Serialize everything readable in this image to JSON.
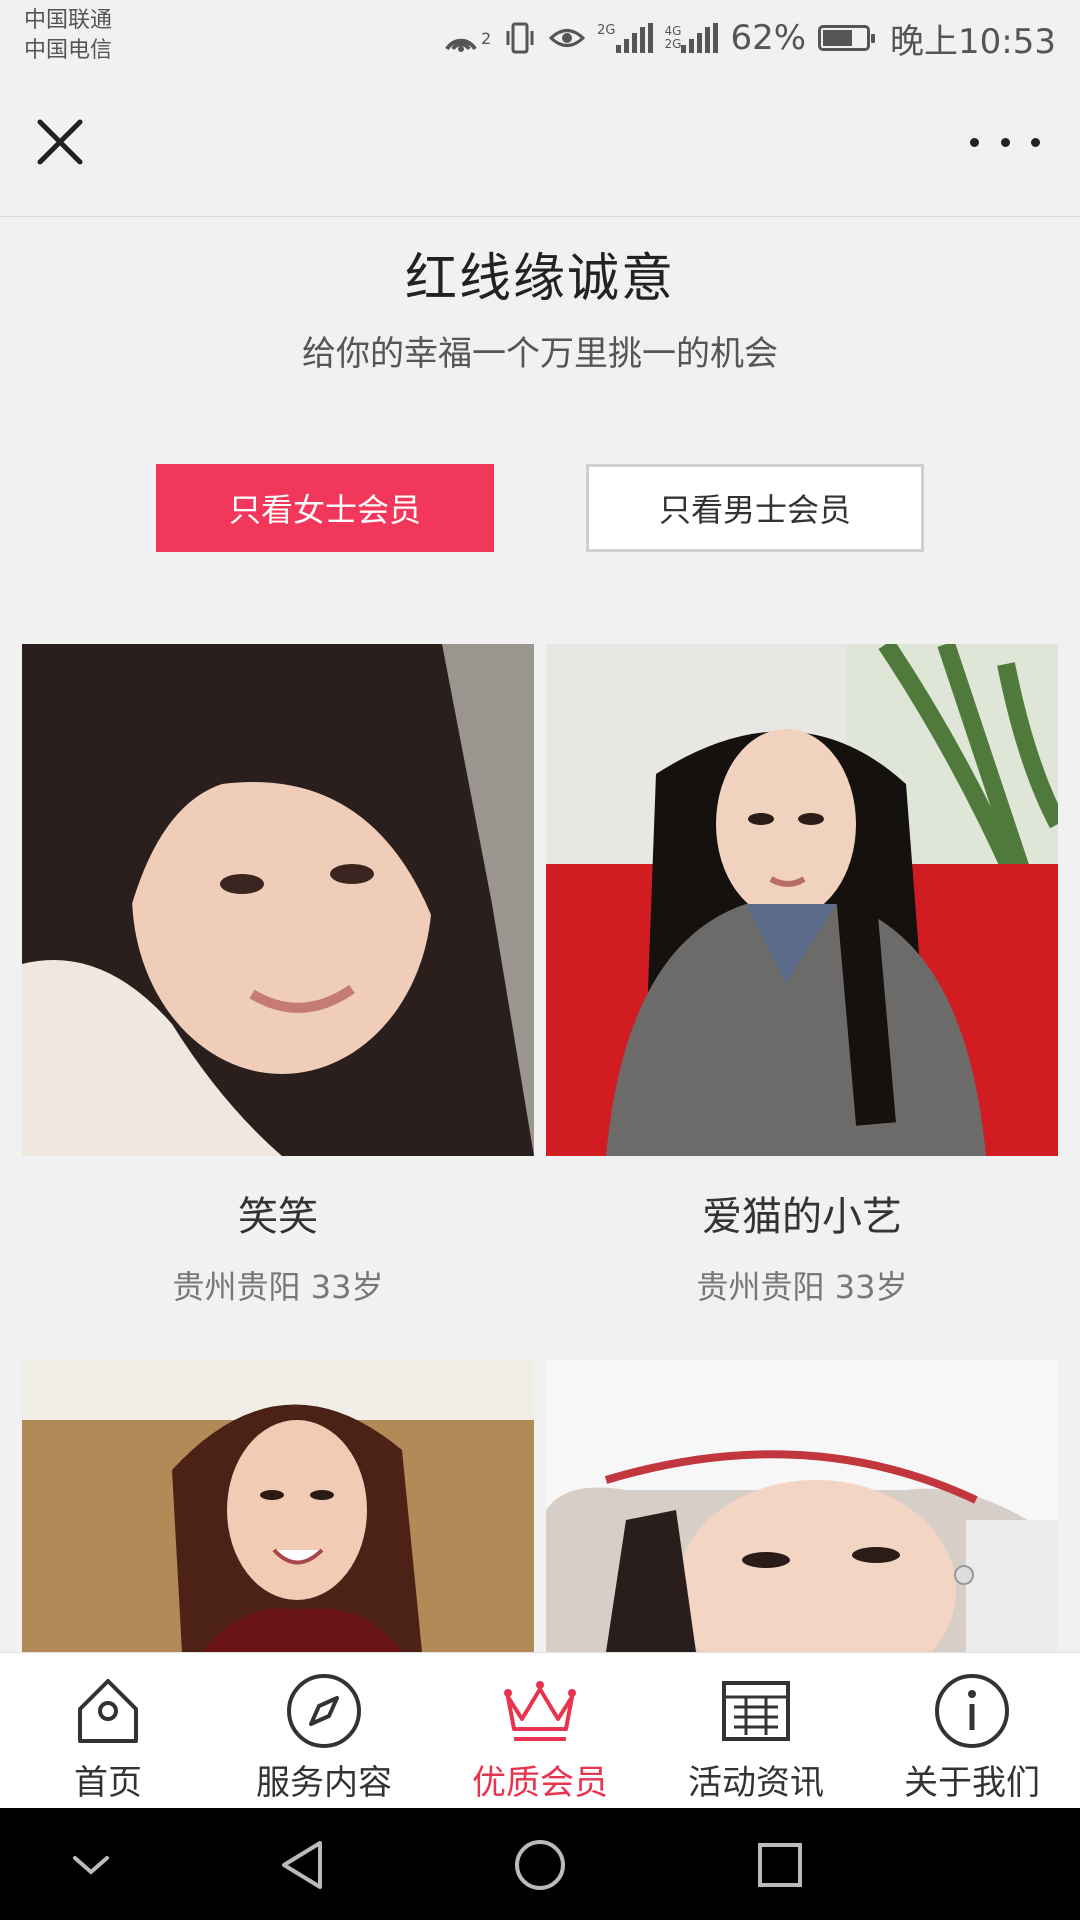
{
  "status_bar": {
    "carrier1": "中国联通",
    "carrier2": "中国电信",
    "hotspot_badge": "2",
    "net1": "2G",
    "net2_top": "4G",
    "net2_bottom": "2G",
    "battery": "62%",
    "battery_level": 0.62,
    "time": "晚上10:53"
  },
  "topnav": {
    "close_icon": "close-icon",
    "more_icon": "more-dots-icon"
  },
  "header": {
    "title": "红线缘诚意",
    "subtitle": "给你的幸福一个万里挑一的机会"
  },
  "filters": {
    "female": "只看女士会员",
    "male": "只看男士会员",
    "active_color": "#f2385a"
  },
  "members": [
    {
      "name": "笑笑",
      "info": "贵州贵阳 33岁"
    },
    {
      "name": "爱猫的小艺",
      "info": "贵州贵阳 33岁"
    },
    {
      "name": "",
      "info": ""
    },
    {
      "name": "",
      "info": ""
    }
  ],
  "tabs": [
    {
      "label": "首页",
      "icon": "home-icon"
    },
    {
      "label": "服务内容",
      "icon": "compass-icon"
    },
    {
      "label": "优质会员",
      "icon": "crown-icon",
      "active": true
    },
    {
      "label": "活动资讯",
      "icon": "calendar-icon"
    },
    {
      "label": "关于我们",
      "icon": "info-icon"
    }
  ],
  "colors": {
    "accent": "#e8344e",
    "background": "#f1f1f1"
  }
}
